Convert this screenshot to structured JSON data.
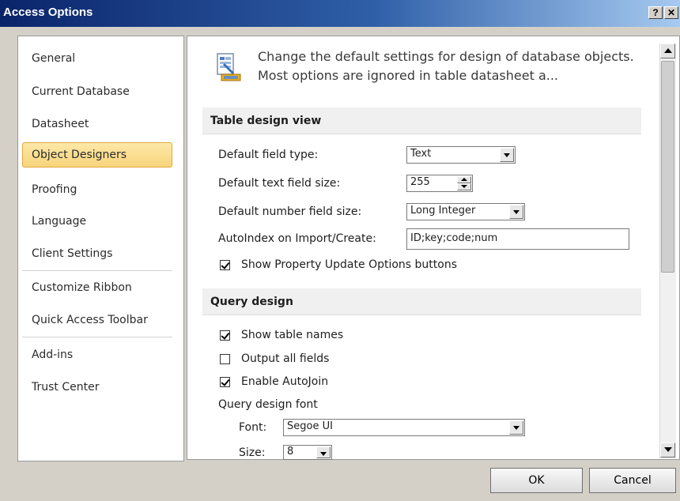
{
  "window": {
    "title": "Access Options",
    "help_glyph": "?",
    "close_glyph": "✕"
  },
  "nav": {
    "items": [
      {
        "label": "General"
      },
      {
        "label": "Current Database"
      },
      {
        "label": "Datasheet"
      },
      {
        "label": "Object Designers",
        "selected": true
      },
      {
        "label": "Proofing"
      },
      {
        "label": "Language"
      },
      {
        "label": "Client Settings"
      },
      {
        "label": "Customize Ribbon"
      },
      {
        "label": "Quick Access Toolbar"
      },
      {
        "label": "Add-ins"
      },
      {
        "label": "Trust Center"
      }
    ]
  },
  "header": {
    "icon": "design-options-icon",
    "text": "Change the default settings for design of database objects. Most options are ignored in table datasheet a..."
  },
  "table_design": {
    "title": "Table design view",
    "default_field_type": {
      "label": "Default field type:",
      "value": "Text"
    },
    "default_text_field_size": {
      "label": "Default text field size:",
      "value": "255"
    },
    "default_number_field_size": {
      "label": "Default number field size:",
      "value": "Long Integer"
    },
    "autoindex": {
      "label": "AutoIndex on Import/Create:",
      "value": "ID;key;code;num"
    },
    "show_property_update": {
      "label": "Show Property Update Options buttons",
      "checked": true
    }
  },
  "query_design": {
    "title": "Query design",
    "show_table_names": {
      "label": "Show table names",
      "checked": true
    },
    "output_all_fields": {
      "label": "Output all fields",
      "checked": false
    },
    "enable_autojoin": {
      "label": "Enable AutoJoin",
      "checked": true
    },
    "font_group_label": "Query design font",
    "font": {
      "label": "Font:",
      "value": "Segoe UI"
    },
    "size": {
      "label": "Size:",
      "value": "8"
    }
  },
  "buttons": {
    "ok": "OK",
    "cancel": "Cancel"
  },
  "colors": {
    "selected_bg": "#f7d47c",
    "selected_border": "#e0a840",
    "titlebar": "#0a246a"
  }
}
